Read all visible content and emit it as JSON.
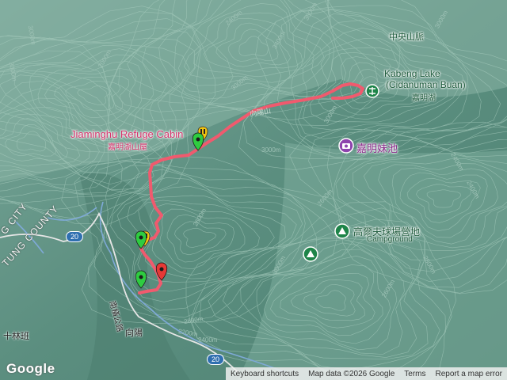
{
  "labels": {
    "kabeng_lake": "Kabeng Lake",
    "kabeng_lake_native": "(Cidanuman Buan)",
    "kabeng_lake_zh": "嘉明湖",
    "refuge_cabin": "Jiaminghu Refuge Cabin",
    "refuge_cabin_zh": "嘉明湖山屋",
    "sister_pond": "嘉明妹池",
    "campground_zh": "高爾夫球場營地",
    "campground": "Campground",
    "central_range": "中央山脈",
    "county_city": "G CITY",
    "county": "TUNG COUNTY",
    "xiangyang": "向陽",
    "shilin": "十林班",
    "highway": "南橫公路",
    "trail": "向陽山"
  },
  "route_badges": [
    "20",
    "20"
  ],
  "contour_labels": [
    "3000m",
    "3000m",
    "2400m",
    "3000m",
    "3400m",
    "3000m",
    "3000m",
    "3000m",
    "2600m",
    "2600m",
    "3000m",
    "2400m",
    "2400m",
    "2800m",
    "2600m",
    "3000m",
    "2800m",
    "2200m",
    "2400m",
    "2000m"
  ],
  "colors": {
    "track": "#f05a6e",
    "marker_green": "#2ecc40",
    "marker_yellow": "#f1c40f",
    "marker_red": "#e53935",
    "poi_green": "#1e8449",
    "poi_purple": "#8e44ad"
  },
  "footer": {
    "logo": "Google",
    "shortcuts": "Keyboard shortcuts",
    "map_data": "Map data ©2026 Google",
    "terms": "Terms",
    "report": "Report a map error"
  }
}
